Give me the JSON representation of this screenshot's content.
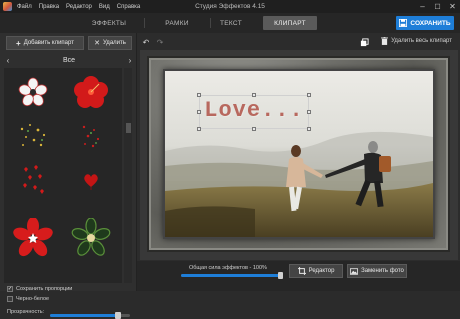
{
  "window": {
    "title": "Студия Эффектов 4.15",
    "menu": [
      "Файл",
      "Правка",
      "Редактор",
      "Вид",
      "Справка"
    ],
    "controls": {
      "minimize": "–",
      "maximize": "☐",
      "close": "✕"
    }
  },
  "tabs": [
    {
      "label": "ЭФФЕКТЫ",
      "active": false
    },
    {
      "label": "РАМКИ",
      "active": false
    },
    {
      "label": "ТЕКСТ",
      "active": false
    },
    {
      "label": "КЛИПАРТ",
      "active": true
    }
  ],
  "save_button": {
    "label": "СОХРАНИТЬ",
    "icon": "floppy-icon"
  },
  "left_panel": {
    "add_button": {
      "label": "Добавить клипарт",
      "icon": "plus-icon"
    },
    "delete_button": {
      "label": "Удалить",
      "icon": "close-icon"
    },
    "category": {
      "label": "Все",
      "prev": "‹",
      "next": "›"
    },
    "clipart_items": [
      {
        "name": "white-flower"
      },
      {
        "name": "red-hibiscus"
      },
      {
        "name": "gold-sparkles"
      },
      {
        "name": "red-sparkles"
      },
      {
        "name": "red-hearts-small"
      },
      {
        "name": "red-heart-single"
      },
      {
        "name": "red-flower-star"
      },
      {
        "name": "green-flower"
      }
    ],
    "options": {
      "keep_proportions": {
        "label": "Сохранить пропорции",
        "checked": true
      },
      "black_white": {
        "label": "Черно-белое",
        "checked": false
      },
      "transparency": {
        "label": "Прозрачность:",
        "value": 0.85
      }
    }
  },
  "right_panel": {
    "toolbar": {
      "undo": "↶",
      "redo": "↷",
      "delete_all": {
        "label": "Удалить весь клипарт",
        "icon": "trash-icon"
      },
      "layers_icon": "layers-icon"
    },
    "canvas_text": "Love...",
    "bottom": {
      "effects_label": "Общая сила эффектов - 100%",
      "effects_value": 1.0,
      "editor_button": {
        "label": "Редактор",
        "icon": "crop-icon"
      },
      "replace_photo_button": {
        "label": "Заменить фото",
        "icon": "photo-icon"
      }
    }
  },
  "colors": {
    "accent": "#1e7ed8",
    "background": "#2d2d2d",
    "text_on_canvas": "#b8685e"
  }
}
